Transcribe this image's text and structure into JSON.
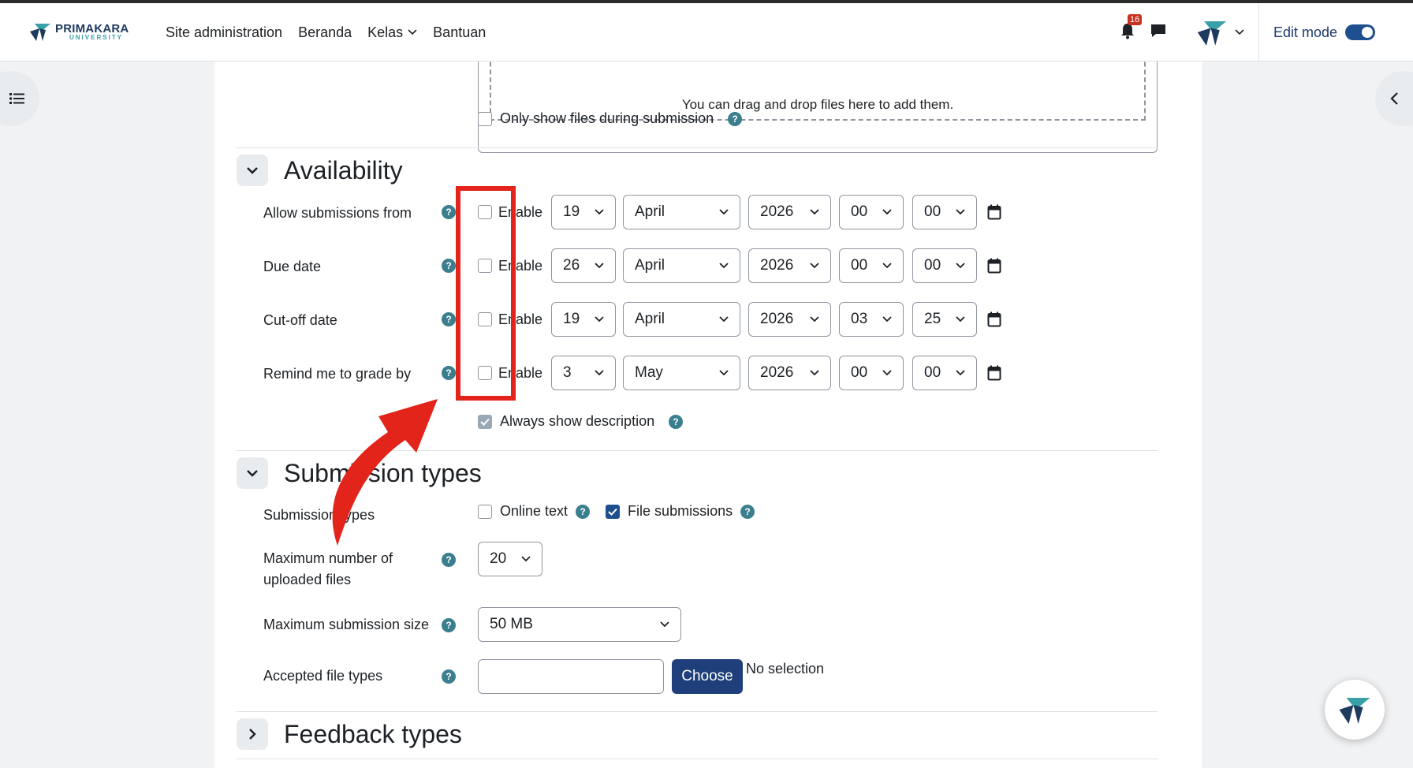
{
  "navbar": {
    "logo_main": "PRIMAKARA",
    "logo_sub": "UNIVERSITY",
    "links": [
      "Site administration",
      "Beranda",
      "Kelas",
      "Bantuan"
    ],
    "notification_count": "16",
    "edit_mode_label": "Edit mode",
    "edit_mode_on": true
  },
  "files": {
    "drop_hint": "You can drag and drop files here to add them.",
    "only_show_label": "Only show files during submission"
  },
  "availability": {
    "title": "Availability",
    "enable_label": "Enable",
    "rows": [
      {
        "label": "Allow submissions from",
        "day": "19",
        "month": "April",
        "year": "2026",
        "hour": "00",
        "minute": "00"
      },
      {
        "label": "Due date",
        "day": "26",
        "month": "April",
        "year": "2026",
        "hour": "00",
        "minute": "00"
      },
      {
        "label": "Cut-off date",
        "day": "19",
        "month": "April",
        "year": "2026",
        "hour": "03",
        "minute": "25"
      },
      {
        "label": "Remind me to grade by",
        "day": "3",
        "month": "May",
        "year": "2026",
        "hour": "00",
        "minute": "00"
      }
    ],
    "always_show_label": "Always show description"
  },
  "submission_types": {
    "title": "Submission types",
    "types_label": "Submission types",
    "online_text_label": "Online text",
    "file_submissions_label": "File submissions",
    "max_files_label": "Maximum number of uploaded files",
    "max_files_value": "20",
    "max_size_label": "Maximum submission size",
    "max_size_value": "50 MB",
    "accepted_types_label": "Accepted file types",
    "choose_label": "Choose",
    "no_selection": "No selection"
  },
  "feedback_types": {
    "title": "Feedback types"
  },
  "colors": {
    "accent": "#1e3f7a",
    "help": "#3b7f8f",
    "highlight": "#e3241b"
  }
}
